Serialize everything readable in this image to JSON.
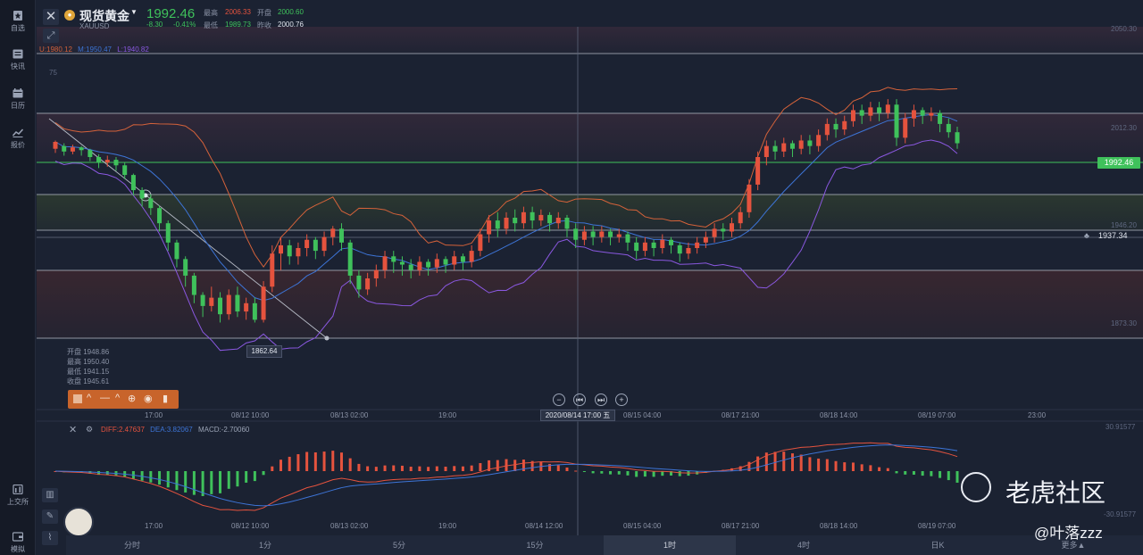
{
  "rail": {
    "items": [
      {
        "label": "自选",
        "icon": "star-bookmark-icon"
      },
      {
        "label": "快讯",
        "icon": "news-icon"
      },
      {
        "label": "日历",
        "icon": "calendar-icon"
      },
      {
        "label": "报价",
        "icon": "quote-chart-icon"
      }
    ],
    "bottom_items": [
      {
        "label": "上交所",
        "icon": "exchange-icon"
      },
      {
        "label": "模拟",
        "icon": "wallet-icon"
      }
    ]
  },
  "symbol": {
    "name": "现货黄金",
    "code": "XAUUSD",
    "price": "1992.46",
    "change": "-8.30",
    "change_pct": "-0.41%",
    "stats": {
      "high_label": "最高",
      "high": "2006.33",
      "open_label": "开盘",
      "open": "2000.60",
      "low_label": "最低",
      "low": "1989.73",
      "prev_label": "昨收",
      "prev": "2000.76"
    }
  },
  "bollinger": {
    "u": "U:1980.12",
    "m": "M:1950.47",
    "l": "L:1940.82"
  },
  "price_axis": {
    "labels": [
      "2050.30",
      "2012.30",
      "1946.20",
      "1873.30"
    ],
    "current_price": "1992.46",
    "reference_price": "1937.34",
    "left_tick": "75"
  },
  "ohlc_panel": {
    "open": "开盘 1948.86",
    "high": "最高 1950.40",
    "low": "最低 1941.15",
    "close": "收盘 1945.61"
  },
  "low_marker": "1862.64",
  "crosshair_time": "2020/08/14 17:00 五",
  "time_axis": [
    "17:00",
    "08/12 10:00",
    "08/13 02:00",
    "19:00",
    "08/15 04:00",
    "08/17 21:00",
    "08/18 14:00",
    "08/19 07:00",
    "23:00"
  ],
  "macd_time_axis": [
    "17:00",
    "08/12 10:00",
    "08/13 02:00",
    "19:00",
    "08/14 12:00",
    "08/15 04:00",
    "08/17 21:00",
    "08/18 14:00",
    "08/19 07:00"
  ],
  "macd": {
    "diff": "DIFF:2.47637",
    "dea": "DEA:3.82067",
    "macd": "MACD:-2.70060",
    "max": "30.91577",
    "min": "-30.91577"
  },
  "periods": [
    {
      "label": "分时",
      "active": false
    },
    {
      "label": "1分",
      "active": false
    },
    {
      "label": "5分",
      "active": false
    },
    {
      "label": "15分",
      "active": false
    },
    {
      "label": "1时",
      "active": true
    },
    {
      "label": "4时",
      "active": false
    },
    {
      "label": "日K",
      "active": false
    },
    {
      "label": "更多▲",
      "active": false
    }
  ],
  "watermark": {
    "brand": "老虎社区",
    "user": "@叶落zzz"
  },
  "colors": {
    "up": "#e5533e",
    "down": "#3fc15b",
    "upper_band": "#d4623a",
    "mid_band": "#3d74d6",
    "lower_band": "#8a58e0"
  },
  "chart_data": {
    "type": "candlestick",
    "candles": [
      [
        1988,
        1993,
        1985,
        1994
      ],
      [
        1990,
        1986,
        1983,
        1992
      ],
      [
        1986,
        1989,
        1984,
        1991
      ],
      [
        1989,
        1987,
        1983,
        1990
      ],
      [
        1987,
        1982,
        1979,
        1988
      ],
      [
        1982,
        1978,
        1974,
        1984
      ],
      [
        1978,
        1980,
        1975,
        1983
      ],
      [
        1980,
        1976,
        1972,
        1982
      ],
      [
        1976,
        1969,
        1966,
        1978
      ],
      [
        1969,
        1958,
        1954,
        1970
      ],
      [
        1958,
        1952,
        1946,
        1960
      ],
      [
        1952,
        1945,
        1940,
        1955
      ],
      [
        1945,
        1934,
        1928,
        1947
      ],
      [
        1934,
        1920,
        1914,
        1936
      ],
      [
        1920,
        1908,
        1902,
        1922
      ],
      [
        1908,
        1896,
        1888,
        1910
      ],
      [
        1896,
        1882,
        1876,
        1898
      ],
      [
        1882,
        1874,
        1866,
        1884
      ],
      [
        1874,
        1880,
        1870,
        1888
      ],
      [
        1880,
        1868,
        1862,
        1884
      ],
      [
        1868,
        1882,
        1864,
        1886
      ],
      [
        1882,
        1870,
        1866,
        1888
      ],
      [
        1870,
        1876,
        1864,
        1880
      ],
      [
        1876,
        1864,
        1862,
        1880
      ],
      [
        1864,
        1888,
        1862,
        1892
      ],
      [
        1888,
        1912,
        1884,
        1918
      ],
      [
        1912,
        1918,
        1900,
        1924
      ],
      [
        1918,
        1910,
        1904,
        1922
      ],
      [
        1910,
        1916,
        1904,
        1920
      ],
      [
        1916,
        1922,
        1910,
        1926
      ],
      [
        1922,
        1914,
        1908,
        1924
      ],
      [
        1914,
        1924,
        1910,
        1928
      ],
      [
        1924,
        1930,
        1918,
        1932
      ],
      [
        1930,
        1920,
        1914,
        1934
      ],
      [
        1920,
        1896,
        1890,
        1922
      ],
      [
        1896,
        1886,
        1880,
        1900
      ],
      [
        1886,
        1894,
        1882,
        1898
      ],
      [
        1894,
        1900,
        1888,
        1904
      ],
      [
        1900,
        1910,
        1894,
        1914
      ],
      [
        1910,
        1906,
        1898,
        1914
      ],
      [
        1906,
        1904,
        1896,
        1910
      ],
      [
        1904,
        1900,
        1894,
        1908
      ],
      [
        1900,
        1906,
        1896,
        1910
      ],
      [
        1906,
        1902,
        1896,
        1908
      ],
      [
        1902,
        1908,
        1898,
        1912
      ],
      [
        1908,
        1904,
        1898,
        1910
      ],
      [
        1904,
        1910,
        1900,
        1914
      ],
      [
        1910,
        1906,
        1900,
        1912
      ],
      [
        1906,
        1914,
        1902,
        1918
      ],
      [
        1914,
        1926,
        1910,
        1930
      ],
      [
        1926,
        1936,
        1920,
        1940
      ],
      [
        1936,
        1930,
        1924,
        1942
      ],
      [
        1930,
        1938,
        1926,
        1942
      ],
      [
        1938,
        1934,
        1928,
        1944
      ],
      [
        1934,
        1942,
        1930,
        1946
      ],
      [
        1942,
        1936,
        1930,
        1946
      ],
      [
        1936,
        1940,
        1932,
        1944
      ],
      [
        1940,
        1934,
        1928,
        1942
      ],
      [
        1934,
        1938,
        1930,
        1942
      ],
      [
        1938,
        1930,
        1924,
        1940
      ],
      [
        1930,
        1922,
        1916,
        1934
      ],
      [
        1922,
        1928,
        1918,
        1932
      ],
      [
        1928,
        1924,
        1918,
        1932
      ],
      [
        1924,
        1928,
        1920,
        1932
      ],
      [
        1928,
        1924,
        1918,
        1930
      ],
      [
        1924,
        1926,
        1920,
        1930
      ],
      [
        1926,
        1920,
        1914,
        1928
      ],
      [
        1920,
        1914,
        1908,
        1924
      ],
      [
        1914,
        1920,
        1910,
        1924
      ],
      [
        1920,
        1916,
        1910,
        1922
      ],
      [
        1916,
        1922,
        1912,
        1926
      ],
      [
        1922,
        1918,
        1912,
        1924
      ],
      [
        1918,
        1912,
        1906,
        1920
      ],
      [
        1912,
        1916,
        1908,
        1920
      ],
      [
        1916,
        1920,
        1912,
        1924
      ],
      [
        1920,
        1924,
        1916,
        1928
      ],
      [
        1924,
        1930,
        1920,
        1934
      ],
      [
        1930,
        1928,
        1922,
        1934
      ],
      [
        1928,
        1934,
        1924,
        1938
      ],
      [
        1934,
        1942,
        1930,
        1946
      ],
      [
        1942,
        1962,
        1938,
        1966
      ],
      [
        1962,
        1982,
        1958,
        1986
      ],
      [
        1982,
        1990,
        1976,
        1994
      ],
      [
        1990,
        1986,
        1980,
        1994
      ],
      [
        1986,
        1992,
        1982,
        1996
      ],
      [
        1992,
        1988,
        1982,
        1994
      ],
      [
        1988,
        1994,
        1984,
        1998
      ],
      [
        1994,
        1990,
        1984,
        1998
      ],
      [
        1990,
        1998,
        1986,
        2002
      ],
      [
        1998,
        2006,
        1994,
        2010
      ],
      [
        2006,
        2002,
        1996,
        2010
      ],
      [
        2002,
        2008,
        1998,
        2012
      ],
      [
        2008,
        2016,
        2004,
        2020
      ],
      [
        2016,
        2012,
        2006,
        2020
      ],
      [
        2012,
        2018,
        2008,
        2022
      ],
      [
        2018,
        2014,
        2008,
        2022
      ],
      [
        2014,
        2020,
        2010,
        2024
      ],
      [
        2020,
        1996,
        1990,
        2024
      ],
      [
        1996,
        2010,
        1992,
        2014
      ],
      [
        2010,
        2016,
        2004,
        2020
      ],
      [
        2016,
        2012,
        2006,
        2018
      ],
      [
        2012,
        2014,
        2008,
        2018
      ],
      [
        2014,
        2006,
        2000,
        2016
      ],
      [
        2006,
        2000,
        1996,
        2010
      ],
      [
        2000,
        1992,
        1988,
        2004
      ]
    ],
    "y_range": [
      1850,
      2070
    ]
  }
}
